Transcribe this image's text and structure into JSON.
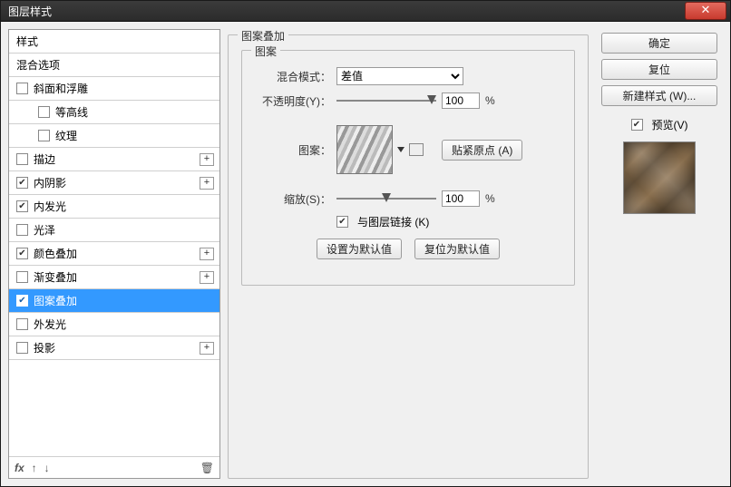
{
  "window": {
    "title": "图层样式"
  },
  "sidebar": {
    "header1": "样式",
    "header2": "混合选项",
    "items": [
      {
        "label": "斜面和浮雕",
        "checked": false,
        "has_add": false,
        "sub": [
          {
            "label": "等高线",
            "checked": false
          },
          {
            "label": "纹理",
            "checked": false
          }
        ]
      },
      {
        "label": "描边",
        "checked": false,
        "has_add": true
      },
      {
        "label": "内阴影",
        "checked": true,
        "has_add": true
      },
      {
        "label": "内发光",
        "checked": true,
        "has_add": false
      },
      {
        "label": "光泽",
        "checked": false,
        "has_add": false
      },
      {
        "label": "颜色叠加",
        "checked": true,
        "has_add": true
      },
      {
        "label": "渐变叠加",
        "checked": false,
        "has_add": true
      },
      {
        "label": "图案叠加",
        "checked": true,
        "has_add": false,
        "selected": true
      },
      {
        "label": "外发光",
        "checked": false,
        "has_add": false
      },
      {
        "label": "投影",
        "checked": false,
        "has_add": true
      }
    ]
  },
  "center": {
    "group_title": "图案叠加",
    "inner_title": "图案",
    "blend_label": "混合模式：",
    "blend_value": "差值",
    "opacity_label": "不透明度(Y)：",
    "opacity_value": "100",
    "opacity_unit": "%",
    "pattern_label": "图案：",
    "snap_label": "贴紧原点 (A)",
    "scale_label": "缩放(S)：",
    "scale_value": "100",
    "scale_unit": "%",
    "link_label": "与图层链接 (K)",
    "link_checked": true,
    "btn_default": "设置为默认值",
    "btn_reset": "复位为默认值"
  },
  "right": {
    "btn_ok": "确定",
    "btn_cancel": "复位",
    "btn_newstyle": "新建样式 (W)...",
    "preview_label": "预览(V)",
    "preview_checked": true
  }
}
